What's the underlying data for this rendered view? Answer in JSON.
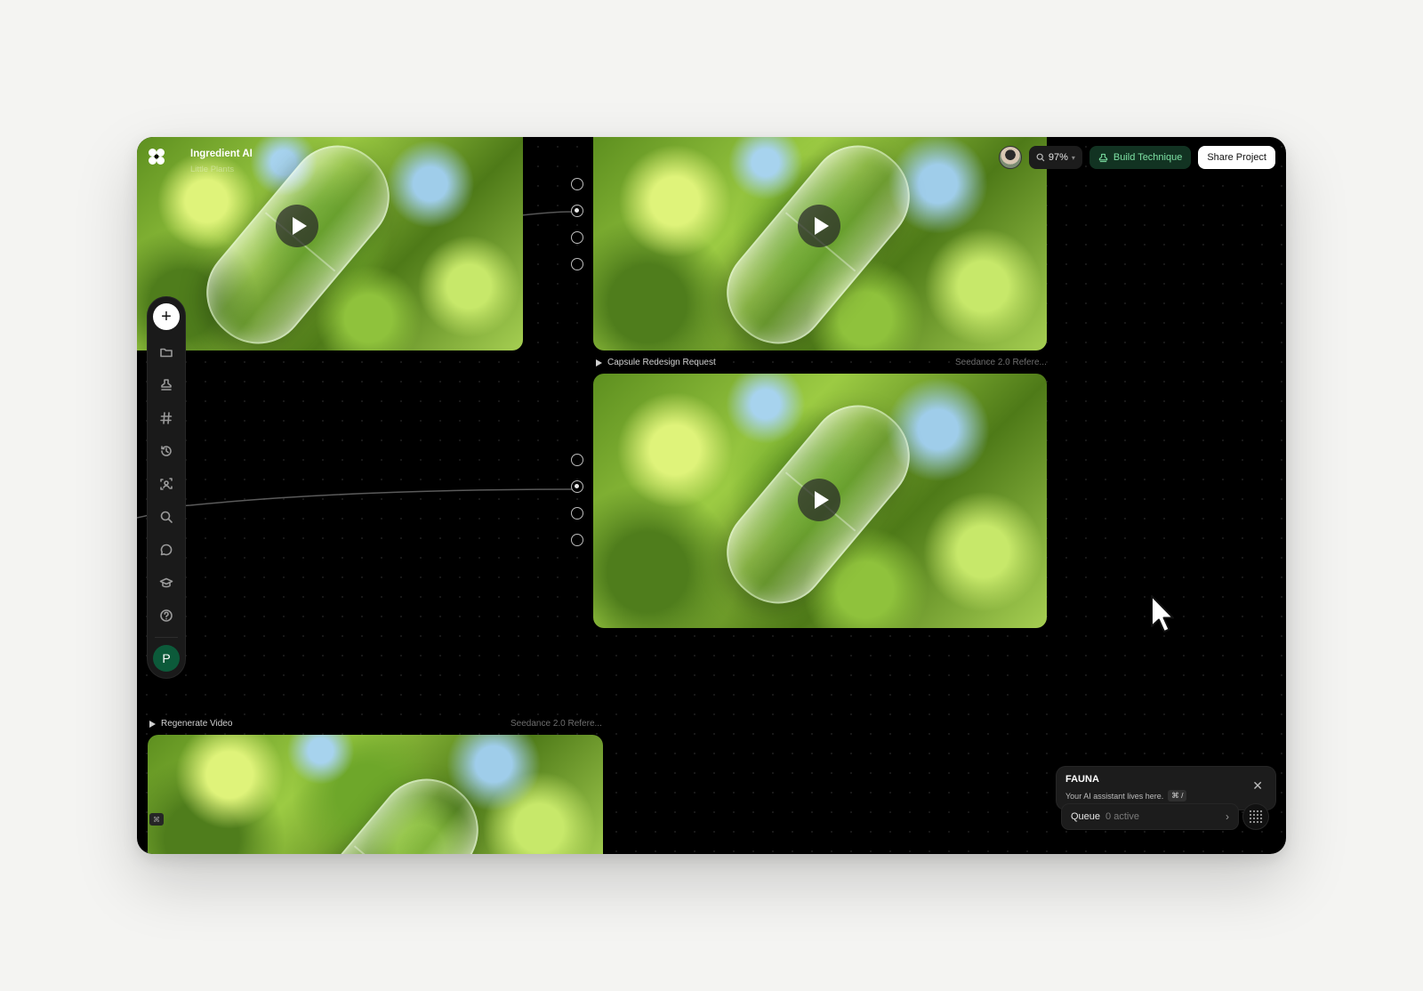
{
  "header": {
    "title": "Ingredient AI",
    "subtitle": "Little Plants",
    "zoom": "97%",
    "build_label": "Build Technique",
    "share_label": "Share Project"
  },
  "sidebar": {
    "items": [
      "add",
      "folder",
      "stamp",
      "hash",
      "history",
      "scan-face",
      "search",
      "chat",
      "graduation",
      "help"
    ],
    "user_initial": "P"
  },
  "nodes": {
    "capsule": {
      "label": "Capsule Redesign Request",
      "model": "Seedance 2.0 Refere..."
    },
    "regenerate": {
      "label": "Regenerate Video",
      "model": "Seedance 2.0 Refere..."
    }
  },
  "fauna": {
    "title": "FAUNA",
    "subtitle": "Your AI assistant lives here.",
    "shortcut": "⌘ /"
  },
  "queue": {
    "label": "Queue",
    "count": "0 active"
  },
  "colors": {
    "canvas": "#000000",
    "accent_green": "#7ee2a4",
    "build_bg": "#123322",
    "user_avatar": "#0c5a3a"
  }
}
